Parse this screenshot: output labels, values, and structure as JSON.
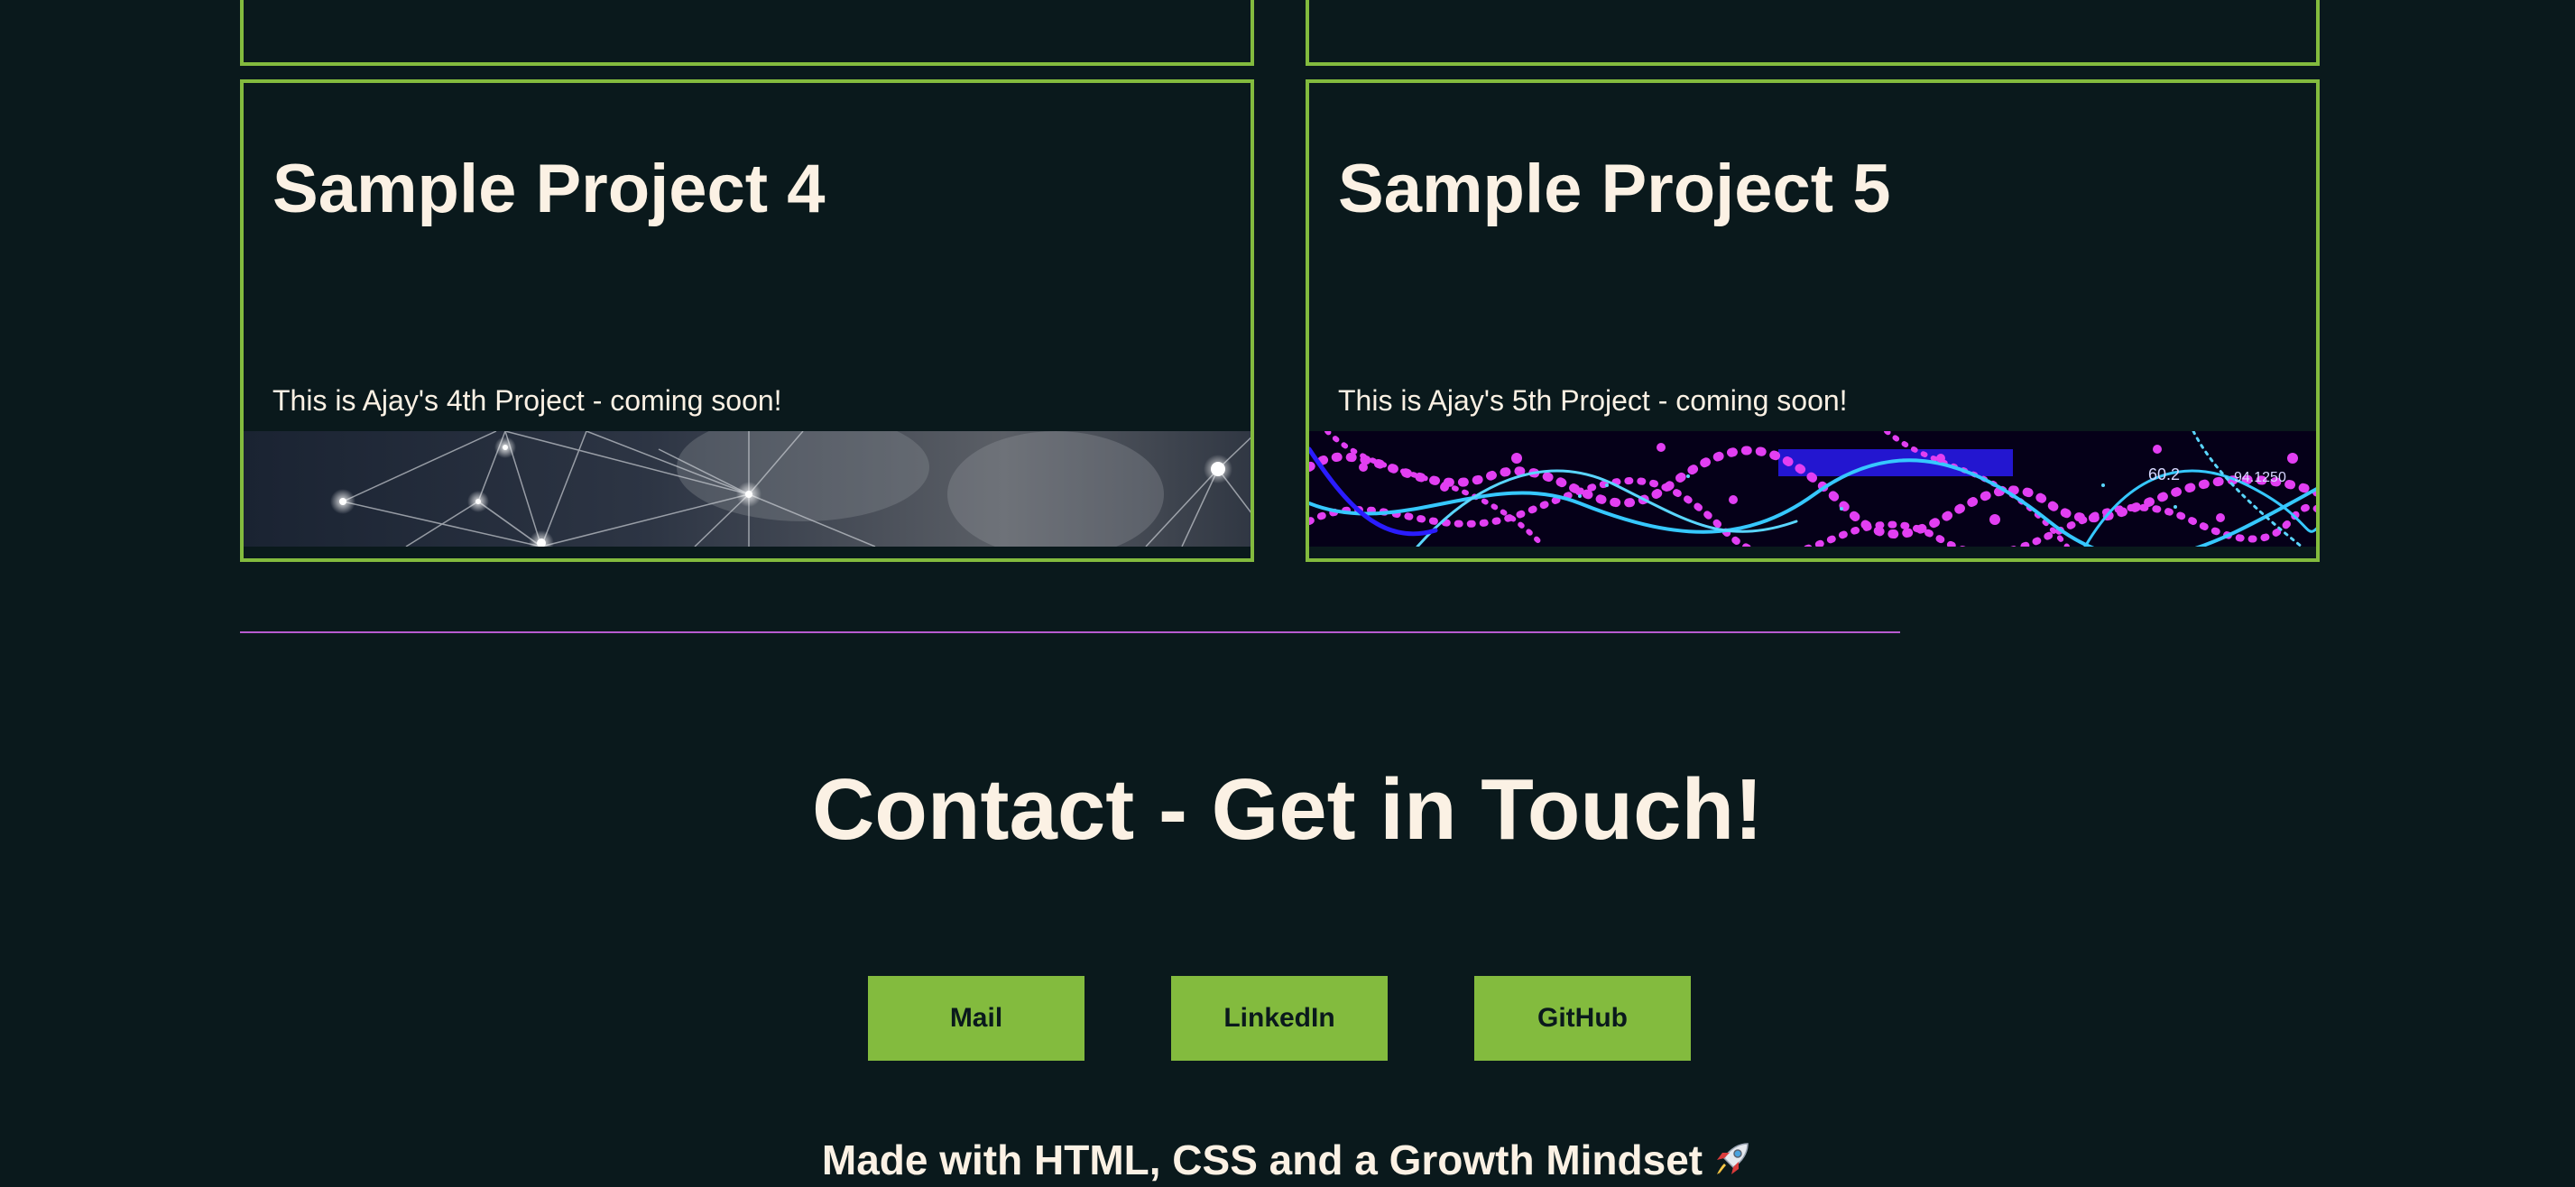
{
  "projects": [
    {
      "title": "Sample Project 4",
      "description": "This is Ajay's 4th Project - coming soon!",
      "banner_icon": "network-nodes-image"
    },
    {
      "title": "Sample Project 5",
      "description": "This is Ajay's 5th Project - coming soon!",
      "banner_icon": "neon-waves-image",
      "banner_text": [
        "60.2",
        "94.1250"
      ]
    }
  ],
  "contact": {
    "heading": "Contact - Get in Touch!",
    "buttons": {
      "mail": "Mail",
      "linkedin": "LinkedIn",
      "github": "GitHub"
    }
  },
  "footer": {
    "text": "Made with HTML, CSS and a Growth Mindset",
    "icon": "rocket-icon"
  },
  "colors": {
    "background": "#0a191c",
    "accent_green": "#83bb3e",
    "divider_purple": "#b85bd0",
    "text_cream": "#fbf1e4"
  }
}
